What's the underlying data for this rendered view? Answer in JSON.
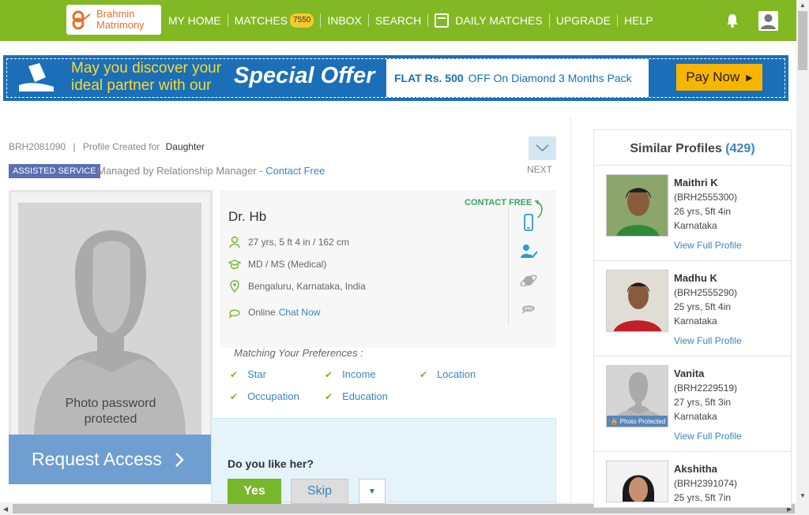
{
  "header": {
    "logo_line1": "Brahmin",
    "logo_line2": "Matrimony",
    "nav": {
      "my_home": "MY HOME",
      "matches": "MATCHES",
      "matches_badge": "7550",
      "inbox": "INBOX",
      "search": "SEARCH",
      "daily_matches": "DAILY MATCHES",
      "upgrade": "UPGRADE",
      "help": "HELP"
    }
  },
  "banner": {
    "line1": "May you discover your",
    "line2": "ideal partner with our",
    "special": "Special Offer",
    "flat": "FLAT Rs. 500",
    "offer": "OFF On Diamond 3 Months Pack",
    "pay_now": "Pay Now"
  },
  "profile": {
    "id": "BRH2081090",
    "created_for_label": "Profile Created for",
    "created_for": "Daughter",
    "assisted_badge": "ASSISTED SERVICE",
    "managed_text": "Managed by Relationship Manager -",
    "contact_link": "Contact Free",
    "next_label": "NEXT",
    "name": "Dr. Hb",
    "age_height": "27 yrs, 5 ft 4 in / 162 cm",
    "education": "MD / MS (Medical)",
    "location": "Bengaluru, Karnataka, India",
    "online": "Online",
    "chat_now": "Chat Now",
    "contact_free": "CONTACT FREE",
    "photo_text": "Photo password protected",
    "request_access": "Request Access",
    "matching_title": "Matching Your Preferences :",
    "matching": [
      "Star",
      "Income",
      "Location",
      "Occupation",
      "Education"
    ],
    "like_question": "Do you like her?",
    "yes": "Yes",
    "skip": "Skip"
  },
  "similar": {
    "title": "Similar Profiles",
    "count": "(429)",
    "view_label": "View Full Profile",
    "items": [
      {
        "name": "Maithri K",
        "id": "(BRH2555300)",
        "age": "26 yrs, 5ft 4in",
        "state": "Karnataka"
      },
      {
        "name": "Madhu K",
        "id": "(BRH2555290)",
        "age": "25 yrs, 5ft 4in",
        "state": "Karnataka"
      },
      {
        "name": "Vanita",
        "id": "(BRH2229519)",
        "age": "27 yrs, 5ft 3in",
        "state": "Karnataka",
        "protected": "Photo Protected"
      },
      {
        "name": "Akshitha",
        "id": "(BRH2391074)",
        "age": "25 yrs, 5ft 7in",
        "state": ""
      }
    ]
  },
  "colors": {
    "green": "#82b823",
    "blue": "#1a6fb8",
    "link": "#3a85c4"
  }
}
